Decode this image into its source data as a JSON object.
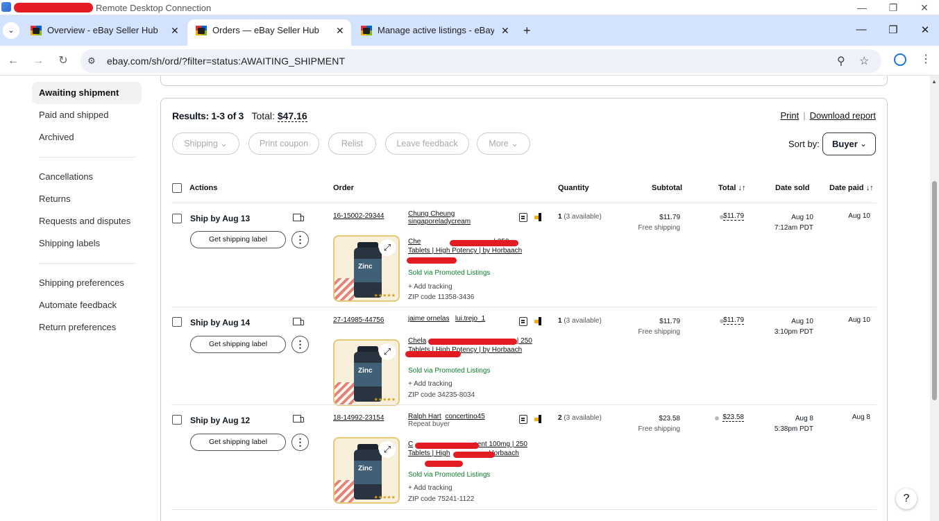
{
  "rdp": {
    "title": "Remote Desktop Connection"
  },
  "browser": {
    "tabs": [
      {
        "label": "Overview - eBay Seller Hub"
      },
      {
        "label": "Orders — eBay Seller Hub"
      },
      {
        "label": "Manage active listings - eBay Se"
      }
    ],
    "url": "ebay.com/sh/ord/?filter=status:AWAITING_SHIPMENT"
  },
  "sidebar": {
    "group1": [
      {
        "label": "Awaiting shipment",
        "active": true
      },
      {
        "label": "Paid and shipped"
      },
      {
        "label": "Archived"
      }
    ],
    "group2": [
      {
        "label": "Cancellations"
      },
      {
        "label": "Returns"
      },
      {
        "label": "Requests and disputes"
      },
      {
        "label": "Shipping labels"
      }
    ],
    "group3": [
      {
        "label": "Shipping preferences"
      },
      {
        "label": "Automate feedback"
      },
      {
        "label": "Return preferences"
      }
    ]
  },
  "summary": {
    "results_label": "Results: 1-3 of 3",
    "total_label": "Total:",
    "total_value": "$47.16",
    "print": "Print",
    "separator": "|",
    "download": "Download report"
  },
  "actions": {
    "shipping": "Shipping",
    "print_coupon": "Print coupon",
    "relist": "Relist",
    "leave_feedback": "Leave feedback",
    "more": "More",
    "sort_by": "Sort by:",
    "sort_value": "Buyer"
  },
  "table": {
    "headers": {
      "actions": "Actions",
      "order": "Order",
      "quantity": "Quantity",
      "subtotal": "Subtotal",
      "total": "Total ↓↑",
      "date_sold": "Date sold",
      "date_paid": "Date paid ↓↑"
    },
    "rows": [
      {
        "ship_by": "Ship by Aug 13",
        "label_button": "Get shipping label",
        "order_no": "16-15002-29344",
        "buyer_name": "Chung Cheung",
        "buyer_id": "singaporeladycream",
        "buyer_note": "",
        "title_line1_prefix": "Che",
        "title_line1_suffix": "| 250",
        "title_line2": "Tablets | High Potency | by Horbaach",
        "promoted": "Sold via Promoted Listings",
        "tracking": "+ Add tracking",
        "zip": "ZIP code 11358-3436",
        "qty": "1",
        "available": "(3 available)",
        "subtotal": "$11.79",
        "shipping": "Free shipping",
        "total": "$11.79",
        "date_sold": "Aug 10",
        "time_sold": "7:12am PDT",
        "date_paid": "Aug 10"
      },
      {
        "ship_by": "Ship by Aug 14",
        "label_button": "Get shipping label",
        "order_no": "27-14985-44756",
        "buyer_name": "jaime ornelas",
        "buyer_id": "lui.trejo_1",
        "buyer_note": "",
        "title_line1_prefix": "Chela",
        "title_line1_suffix": "mg | 250",
        "title_line2": "Tablets | High Potency | by Horbaach",
        "promoted": "Sold via Promoted Listings",
        "tracking": "+ Add tracking",
        "zip": "ZIP code 34235-8034",
        "qty": "1",
        "available": "(3 available)",
        "subtotal": "$11.79",
        "shipping": "Free shipping",
        "total": "$11.79",
        "date_sold": "Aug 10",
        "time_sold": "3:10pm PDT",
        "date_paid": "Aug 10"
      },
      {
        "ship_by": "Ship by Aug 12",
        "label_button": "Get shipping label",
        "order_no": "18-14992-23154",
        "buyer_name": "Ralph Hart",
        "buyer_id": "concertino45",
        "buyer_note": "Repeat buyer",
        "title_line1_prefix": "C",
        "title_line1_suffix": "nent 100mg | 250",
        "title_line2": "Tablets | High",
        "title_line2_suffix": "Horbaach",
        "promoted": "Sold via Promoted Listings",
        "tracking": "+ Add tracking",
        "zip": "ZIP code 75241-1122",
        "qty": "2",
        "available": "(3 available)",
        "subtotal": "$23.58",
        "shipping": "Free shipping",
        "total": "$23.58",
        "date_sold": "Aug 8",
        "time_sold": "5:38pm PDT",
        "date_paid": "Aug 8"
      }
    ]
  },
  "product_image_label": "Zinc",
  "help": "?",
  "colors": {
    "redaction": "#e31b23",
    "promoted": "#0b7d2c",
    "accent": "#1a73e8"
  }
}
